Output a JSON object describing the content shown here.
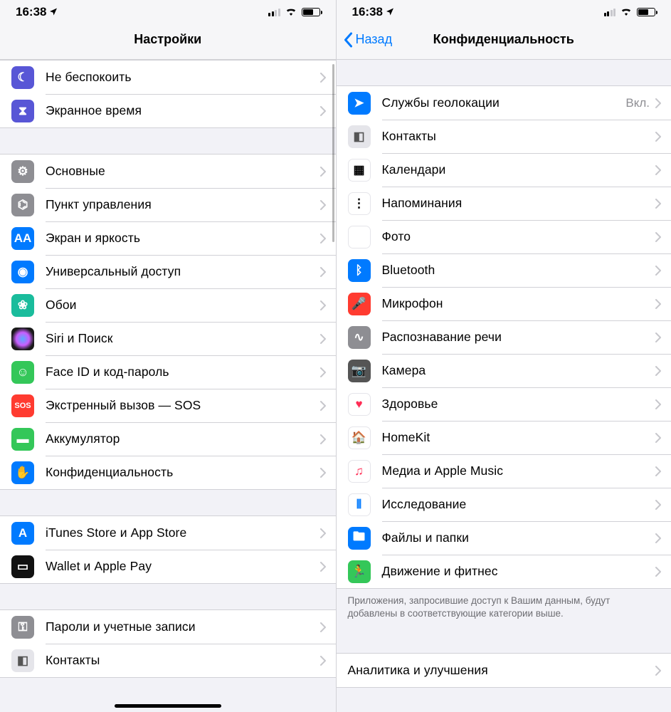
{
  "status": {
    "time": "16:38"
  },
  "left": {
    "title": "Настройки",
    "groups": [
      {
        "rows": [
          {
            "icon": "moon-icon",
            "bg": "bg-purple",
            "glyph": "☾",
            "label": "Не беспокоить"
          },
          {
            "icon": "hourglass-icon",
            "bg": "bg-purple",
            "glyph": "⧗",
            "label": "Экранное время"
          }
        ]
      },
      {
        "rows": [
          {
            "icon": "gear-icon",
            "bg": "bg-grey",
            "glyph": "⚙",
            "label": "Основные"
          },
          {
            "icon": "toggles-icon",
            "bg": "bg-grey",
            "glyph": "⌬",
            "label": "Пункт управления"
          },
          {
            "icon": "text-size-icon",
            "bg": "bg-blue",
            "glyph": "AA",
            "label": "Экран и яркость"
          },
          {
            "icon": "accessibility-icon",
            "bg": "bg-blue",
            "glyph": "◉",
            "label": "Универсальный доступ"
          },
          {
            "icon": "wallpaper-icon",
            "bg": "bg-teal",
            "glyph": "❀",
            "label": "Обои"
          },
          {
            "icon": "siri-icon",
            "bg": "bg-siri",
            "glyph": "",
            "label": "Siri и Поиск"
          },
          {
            "icon": "faceid-icon",
            "bg": "bg-green",
            "glyph": "☺",
            "label": "Face ID и код-пароль"
          },
          {
            "icon": "sos-icon",
            "bg": "bg-red",
            "glyph": "SOS",
            "label": "Экстренный вызов — SOS"
          },
          {
            "icon": "battery-icon",
            "bg": "bg-green",
            "glyph": "▬",
            "label": "Аккумулятор"
          },
          {
            "icon": "hand-icon",
            "bg": "bg-blue",
            "glyph": "✋",
            "label": "Конфиденциальность"
          }
        ]
      },
      {
        "rows": [
          {
            "icon": "appstore-icon",
            "bg": "bg-blue",
            "glyph": "A",
            "label": "iTunes Store и App Store"
          },
          {
            "icon": "wallet-icon",
            "bg": "bg-black",
            "glyph": "▭",
            "label": "Wallet и Apple Pay"
          }
        ]
      },
      {
        "rows": [
          {
            "icon": "key-icon",
            "bg": "bg-grey",
            "glyph": "⚿",
            "label": "Пароли и учетные записи"
          },
          {
            "icon": "contacts-icon",
            "bg": "bg-lgrey",
            "glyph": "◧",
            "label": "Контакты"
          }
        ]
      }
    ]
  },
  "right": {
    "back": "Назад",
    "title": "Конфиденциальность",
    "groups": [
      {
        "rows": [
          {
            "icon": "location-icon",
            "bg": "bg-blue",
            "glyph": "➤",
            "label": "Службы геолокации",
            "detail": "Вкл."
          },
          {
            "icon": "contacts-icon",
            "bg": "bg-lgrey",
            "glyph": "◧",
            "label": "Контакты"
          },
          {
            "icon": "calendar-icon",
            "bg": "bg-white",
            "glyph": "▦",
            "label": "Календари"
          },
          {
            "icon": "reminders-icon",
            "bg": "bg-white",
            "glyph": "⋮",
            "label": "Напоминания"
          },
          {
            "icon": "photos-icon",
            "bg": "bg-photos",
            "glyph": "✿",
            "label": "Фото"
          },
          {
            "icon": "bluetooth-icon",
            "bg": "bg-blue",
            "glyph": "ᛒ",
            "label": "Bluetooth"
          },
          {
            "icon": "microphone-icon",
            "bg": "bg-red",
            "glyph": "🎤",
            "label": "Микрофон"
          },
          {
            "icon": "speech-icon",
            "bg": "bg-grey",
            "glyph": "∿",
            "label": "Распознавание речи"
          },
          {
            "icon": "camera-icon",
            "bg": "bg-darkgrey",
            "glyph": "📷",
            "label": "Камера"
          },
          {
            "icon": "health-icon",
            "bg": "bg-white",
            "glyph": "♥",
            "label": "Здоровье",
            "glyphColor": "#ff2d55"
          },
          {
            "icon": "homekit-icon",
            "bg": "bg-white",
            "glyph": "🏠",
            "label": "HomeKit",
            "glyphColor": "#ff9500"
          },
          {
            "icon": "music-icon",
            "bg": "bg-music",
            "glyph": "♫",
            "label": "Медиа и Apple Music",
            "glyphColor": "#ff2d55"
          },
          {
            "icon": "research-icon",
            "bg": "bg-research",
            "glyph": "⦀",
            "label": "Исследование",
            "glyphColor": "#007aff"
          },
          {
            "icon": "files-icon",
            "bg": "bg-blue",
            "glyph": "🖿",
            "label": "Файлы и папки"
          },
          {
            "icon": "motion-icon",
            "bg": "bg-green",
            "glyph": "🏃",
            "label": "Движение и фитнес"
          }
        ],
        "footer": "Приложения, запросившие доступ к Вашим данным, будут добавлены в соответствующие категории выше."
      },
      {
        "rows": [
          {
            "icon": null,
            "label": "Аналитика и улучшения"
          }
        ]
      }
    ]
  }
}
